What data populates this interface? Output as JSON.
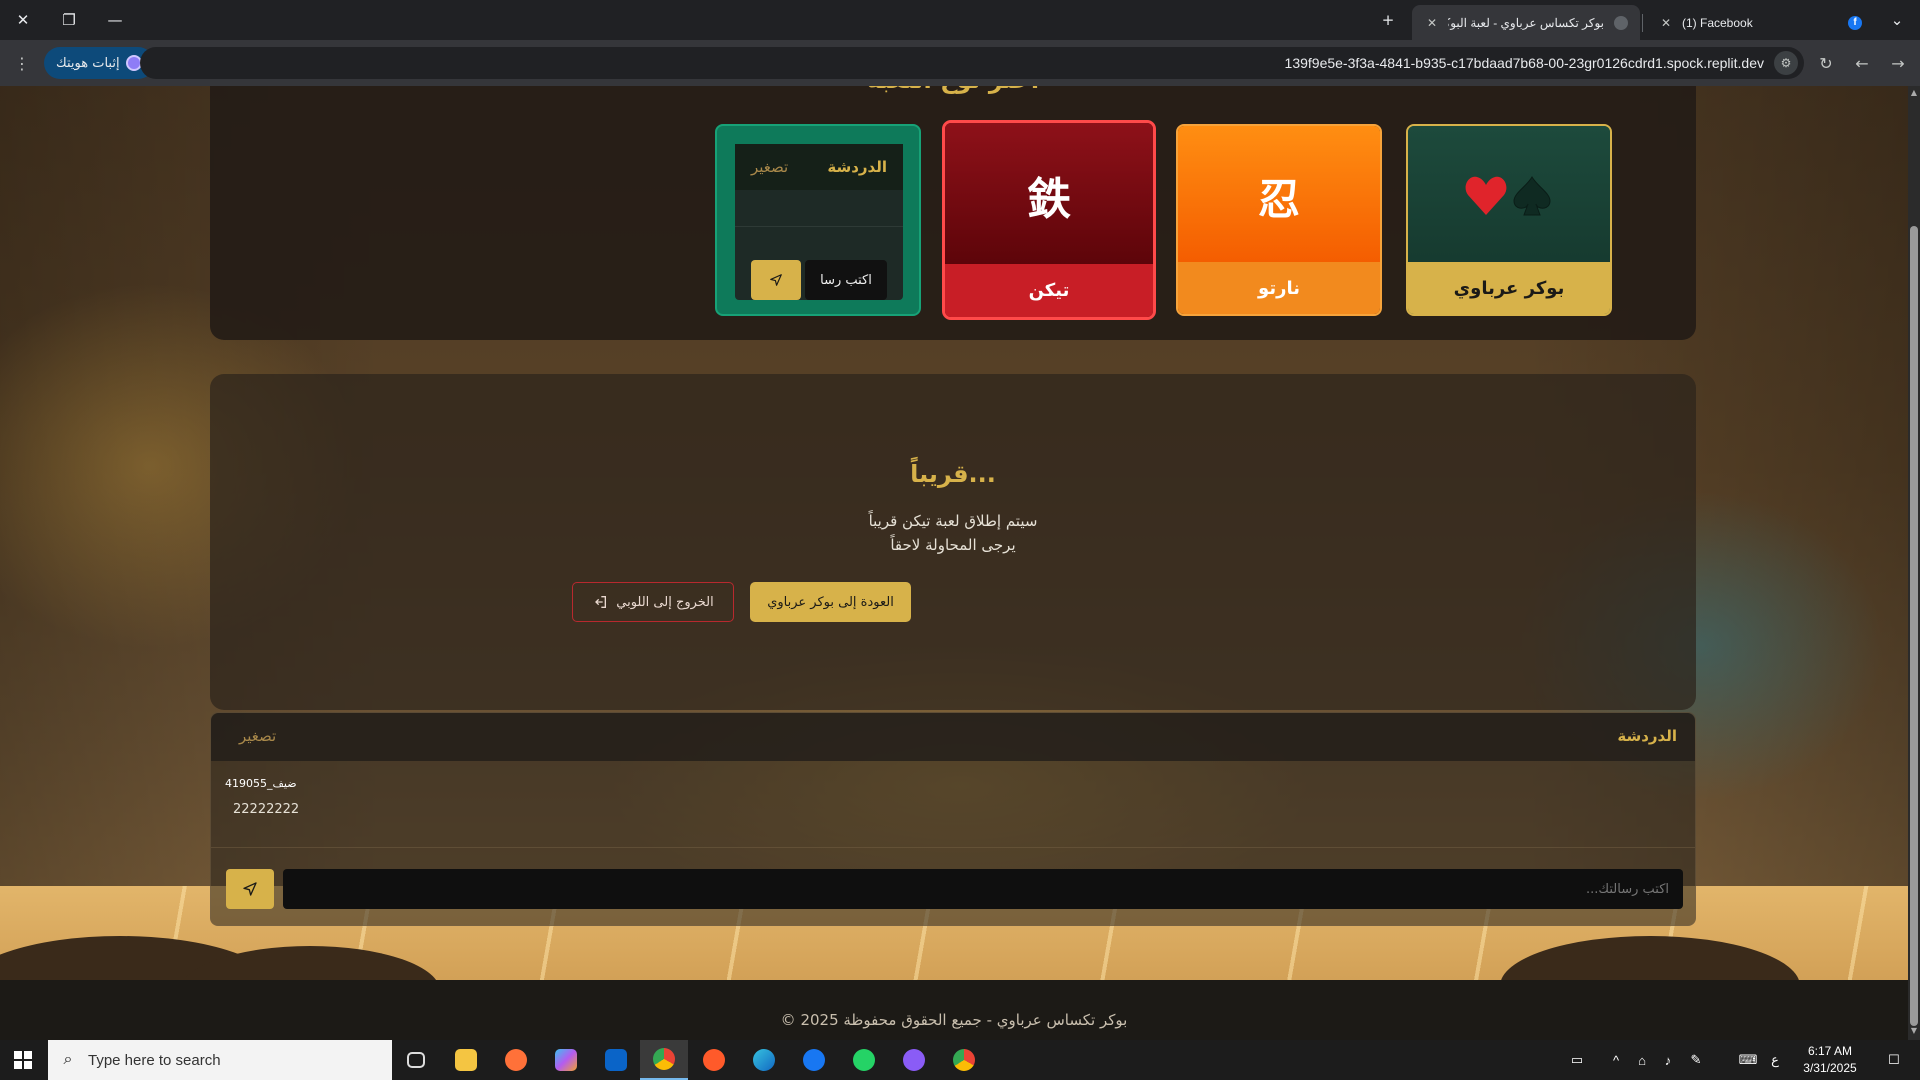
{
  "browser": {
    "tabs": [
      {
        "title": "(1) Facebook",
        "active": false
      },
      {
        "title": "بوكر تكساس عرباوي - لعبة البوكر",
        "active": true
      }
    ],
    "new_tab": "+",
    "url": "139f9e5e-3f3a-4841-b935-c17bdaad7b68-00-23gr0126cdrd1.spock.replit.dev",
    "profile_label": "إثبات هويتك"
  },
  "game_select": {
    "heading": "اختر نوع اللعبة",
    "cards": [
      {
        "label": "بوكر عرباوي",
        "icon": "suits"
      },
      {
        "label": "نارتو",
        "glyph": "忍"
      },
      {
        "label": "تيكن",
        "glyph": "鉄"
      }
    ],
    "mini_chat": {
      "title": "الدردشة",
      "minimize": "تصغير",
      "input_label": "اكتب رسا"
    }
  },
  "coming_soon": {
    "title": "قريباً...",
    "line1": "سيتم إطلاق لعبة تيكن قريباً",
    "line2": "يرجى المحاولة لاحقاً",
    "back_button": "العودة إلى بوكر عرباوي",
    "exit_button": "الخروج إلى اللوبي"
  },
  "chat": {
    "title": "الدردشة",
    "minimize": "تصغير",
    "messages": [
      {
        "user": "ضيف_419055",
        "text": "22222222"
      }
    ],
    "input_placeholder": "اكتب رسالتك..."
  },
  "footer": {
    "text": "© 2025 بوكر تكساس عرباوي - جميع الحقوق محفوظة"
  },
  "taskbar": {
    "search_placeholder": "Type here to search",
    "time": "6:17 AM",
    "date": "3/31/2025",
    "lang": "ع"
  },
  "colors": {
    "gold": "#d7b24a",
    "green": "#1f4a3b",
    "orange": "#f28a1e",
    "red": "#c81e26"
  }
}
